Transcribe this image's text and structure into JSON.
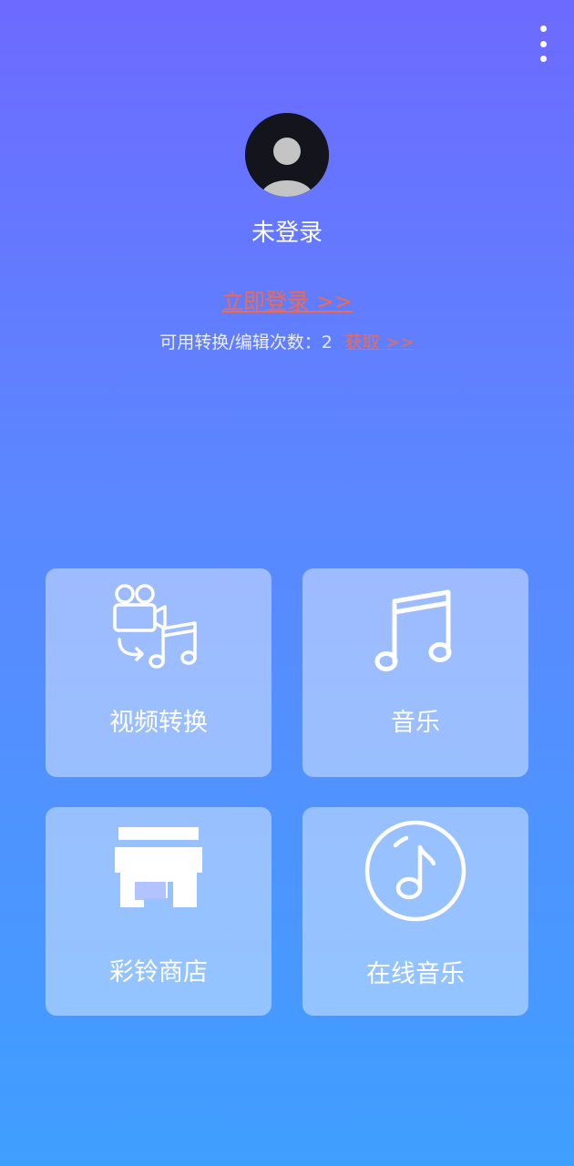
{
  "header": {
    "more_icon": "more-vertical-icon"
  },
  "profile": {
    "avatar_icon": "user-avatar-icon",
    "username": "未登录",
    "login_link": "立即登录 >>",
    "quota_label": "可用转换/编辑次数：2",
    "get_link": "获取 >>"
  },
  "features": [
    {
      "label": "视频转换",
      "icon": "video-to-music-icon"
    },
    {
      "label": "音乐",
      "icon": "music-note-icon"
    },
    {
      "label": "彩铃商店",
      "icon": "store-icon"
    },
    {
      "label": "在线音乐",
      "icon": "online-music-icon"
    }
  ],
  "colors": {
    "gradient_top": "#6d6aff",
    "gradient_bottom": "#3f9fff",
    "link": "#f06a4f",
    "card_bg": "rgba(255,255,255,0.42)"
  }
}
